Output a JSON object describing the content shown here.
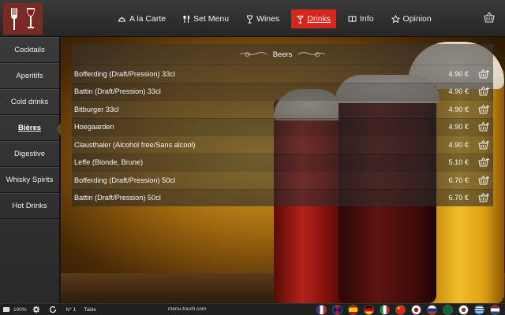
{
  "nav": [
    {
      "label": "A la Carte",
      "icon": "dish-cover-icon",
      "active": false
    },
    {
      "label": "Set Menu",
      "icon": "cutlery-icon",
      "active": false
    },
    {
      "label": "Wines",
      "icon": "wine-glass-icon",
      "active": false
    },
    {
      "label": "Drinks",
      "icon": "cocktail-icon",
      "active": true
    },
    {
      "label": "Info",
      "icon": "book-icon",
      "active": false
    },
    {
      "label": "Opinion",
      "icon": "star-icon",
      "active": false
    }
  ],
  "sidebar": {
    "items": [
      {
        "label": "Cocktails"
      },
      {
        "label": "Aperitifs"
      },
      {
        "label": "Cold drinks"
      },
      {
        "label": "Bières",
        "active": true
      },
      {
        "label": "Digestive"
      },
      {
        "label": "Whisky Spirits"
      },
      {
        "label": "Hot Drinks"
      }
    ]
  },
  "section": {
    "title": "Beers"
  },
  "items": [
    {
      "name": "Bofferding (Draft/Pression) 33cl",
      "price": "4.90 €"
    },
    {
      "name": "Battin (Draft/Pression) 33cl",
      "price": "4.90 €"
    },
    {
      "name": "Bitburger 33cl",
      "price": "4.90 €"
    },
    {
      "name": "Hoegaarden",
      "price": "4.90 €"
    },
    {
      "name": "Clausthaler (Alcohol free/Sans alcool)",
      "price": "4.90 €"
    },
    {
      "name": "Leffe (Blonde, Brune)",
      "price": "5.10 €"
    },
    {
      "name": "Bofferding (Draft/Pression) 50cl",
      "price": "6.70 €"
    },
    {
      "name": "Battin (Draft/Pression) 50cl",
      "price": "6.70 €"
    }
  ],
  "footer": {
    "battery": "100%",
    "table_no": "N° 1",
    "table_label": "Table",
    "site": "menu-touch.com",
    "flags": [
      "france",
      "united-kingdom",
      "spain",
      "germany",
      "italy",
      "china",
      "japan",
      "russia",
      "saudi-arabia",
      "south-korea",
      "greece",
      "netherlands"
    ]
  },
  "colors": {
    "accent": "#d9261c"
  }
}
